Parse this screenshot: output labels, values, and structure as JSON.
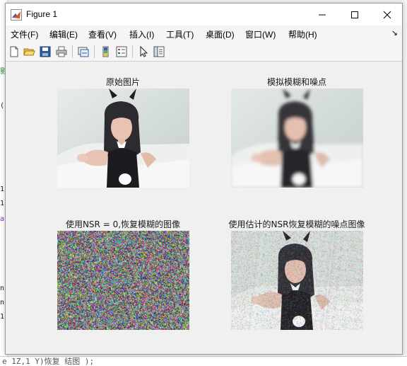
{
  "window": {
    "title": "Figure 1",
    "minimize_label": "minimize",
    "maximize_label": "maximize",
    "close_label": "close"
  },
  "menubar": {
    "items": [
      "文件(F)",
      "编辑(E)",
      "查看(V)",
      "插入(I)",
      "工具(T)",
      "桌面(D)",
      "窗口(W)",
      "帮助(H)"
    ],
    "overflow_icon": "arrow-icon"
  },
  "toolbar": {
    "buttons": [
      "new-figure-icon",
      "open-file-icon",
      "save-icon",
      "print-icon",
      "link-plot-icon",
      "insert-colorbar-icon",
      "insert-legend-icon",
      "pointer-icon",
      "property-editor-icon"
    ]
  },
  "axes": [
    {
      "title": "原始图片"
    },
    {
      "title": "模拟模糊和噪点"
    },
    {
      "title": "使用NSR = 0,恢复模糊的图像"
    },
    {
      "title": "使用估计的NSR恢复模糊的噪点图像"
    }
  ],
  "background": {
    "bottom_text": "e  1Z,1  Y)恢复 结图 );"
  }
}
